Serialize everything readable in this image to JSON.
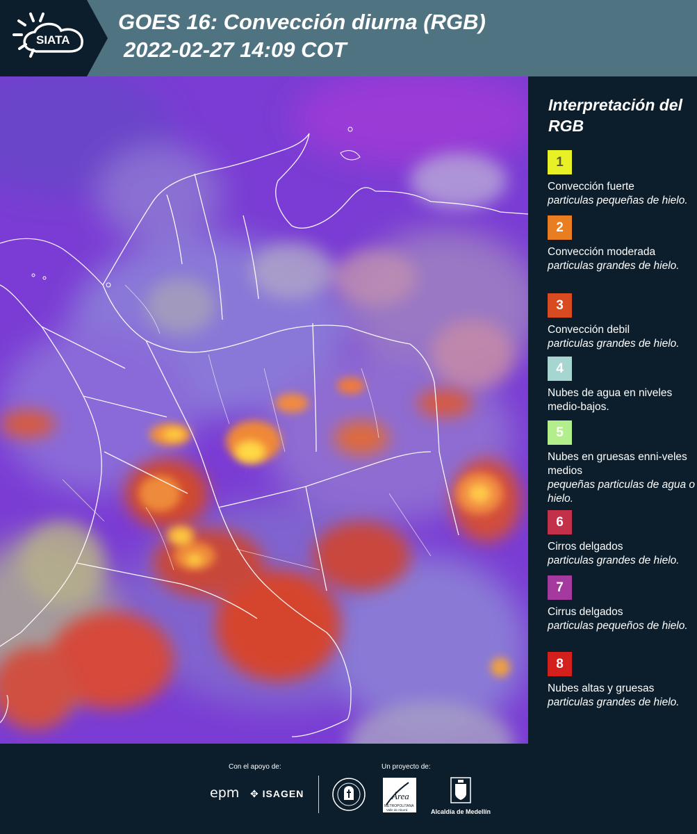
{
  "header": {
    "logo_text": "SIATA",
    "title_line1": "GOES 16: Convección diurna (RGB)",
    "title_line2": "2022-02-27 14:09 COT"
  },
  "legend": {
    "title": "Interpretación del RGB",
    "items": [
      {
        "number": "1",
        "color": "#e8f026",
        "label": "Convección fuerte",
        "desc": "particulas pequeñas de hielo."
      },
      {
        "number": "2",
        "color": "#e87d22",
        "label": "Convección moderada",
        "desc": "particulas grandes de hielo."
      },
      {
        "number": "3",
        "color": "#d84a1f",
        "label": "Convección debil",
        "desc": "particulas grandes de hielo."
      },
      {
        "number": "4",
        "color": "#a6d6cf",
        "label": "Nubes de agua en niveles medio-bajos.",
        "desc": ""
      },
      {
        "number": "5",
        "color": "#b2ee8b",
        "label": "Nubes en gruesas enni-veles medios",
        "desc": "pequeñas particulas de agua o hielo."
      },
      {
        "number": "6",
        "color": "#c2304a",
        "label": "Cirros delgados",
        "desc": "particulas grandes de hielo."
      },
      {
        "number": "7",
        "color": "#a43a9e",
        "label": "Cirrus delgados",
        "desc": "particulas pequeños de hielo."
      },
      {
        "number": "8",
        "color": "#d4201c",
        "label": "Nubes altas y gruesas",
        "desc": "particulas grandes de hielo."
      }
    ]
  },
  "footer": {
    "support_label": "Con el apoyo de:",
    "project_label": "Un proyecto de:",
    "epm_text": "epm",
    "isagen_text": "ISAGEN",
    "area_text": "Área",
    "area_sub": "METROPOLITANA",
    "area_sub2": "Valle de Aburrá",
    "alcaldia_text": "Alcaldía de Medellín"
  },
  "colors": {
    "header_bg": "#4f7380",
    "logo_bg": "#0c1e2b",
    "panel_bg": "#0c1e2b",
    "map_base": "#7b3fd6"
  }
}
